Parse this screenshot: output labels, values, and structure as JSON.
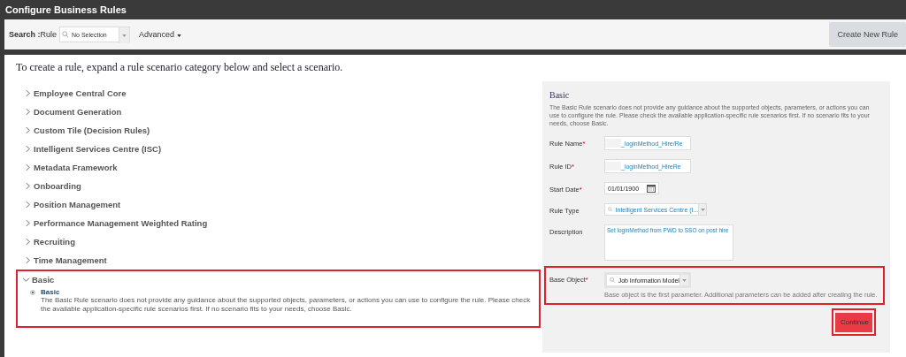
{
  "window": {
    "title": "Configure Business Rules"
  },
  "toolbar": {
    "search_label": "Search :",
    "search_target": "Rule",
    "search_field": {
      "placeholder": "No Selection"
    },
    "advanced": "Advanced",
    "create_button": "Create New Rule"
  },
  "intro": "To create a rule, expand a rule scenario category below and select a scenario.",
  "categories": [
    {
      "label": "Employee Central Core",
      "expanded": false
    },
    {
      "label": "Document Generation",
      "expanded": false
    },
    {
      "label": "Custom Tile (Decision Rules)",
      "expanded": false
    },
    {
      "label": "Intelligent Services Centre (ISC)",
      "expanded": false
    },
    {
      "label": "Metadata Framework",
      "expanded": false
    },
    {
      "label": "Onboarding",
      "expanded": false
    },
    {
      "label": "Position Management",
      "expanded": false
    },
    {
      "label": "Performance Management Weighted Rating",
      "expanded": false
    },
    {
      "label": "Recruiting",
      "expanded": false
    },
    {
      "label": "Time Management",
      "expanded": false
    },
    {
      "label": "Basic",
      "expanded": true,
      "highlighted": true,
      "scenarios": [
        {
          "name": "Basic",
          "selected": true,
          "description": "The Basic Rule scenario does not provide any guidance about the supported objects, parameters, or actions you can use to configure the rule. Please check the available application-specific rule scenarios first. If no scenario fits to your needs, choose Basic."
        }
      ]
    }
  ],
  "panel": {
    "title": "Basic",
    "description": "The Basic Rule scenario does not provide any guidance about the supported objects, parameters, or actions you can use to configure the rule. Please check the available application-specific rule scenarios first. If no scenario fits to your needs, choose Basic.",
    "fields": [
      {
        "kind": "text",
        "label": "Rule Name",
        "required_mark": "*",
        "value": "_loginMethod_Hire/Re"
      },
      {
        "kind": "text",
        "label": "Rule ID",
        "required_mark": "*",
        "value": "_loginMethod_HireRe"
      },
      {
        "kind": "date",
        "label": "Start Date",
        "required_mark": "*",
        "value": "01/01/1900"
      },
      {
        "kind": "select",
        "label": "Rule Type",
        "value": "Intelligent Services Centre (I..."
      },
      {
        "kind": "textarea",
        "label": "Description",
        "value": "Set loginMethod from PWD to SSO on post hire"
      },
      {
        "kind": "select",
        "label": "Base Object",
        "required_mark": "*",
        "value": "Job Information Model",
        "hint": "Base object is the first parameter. Additional parameters can be added after creating the rule.",
        "highlighted": true
      }
    ],
    "continue_button": {
      "label": "Continue",
      "highlighted": true
    }
  }
}
